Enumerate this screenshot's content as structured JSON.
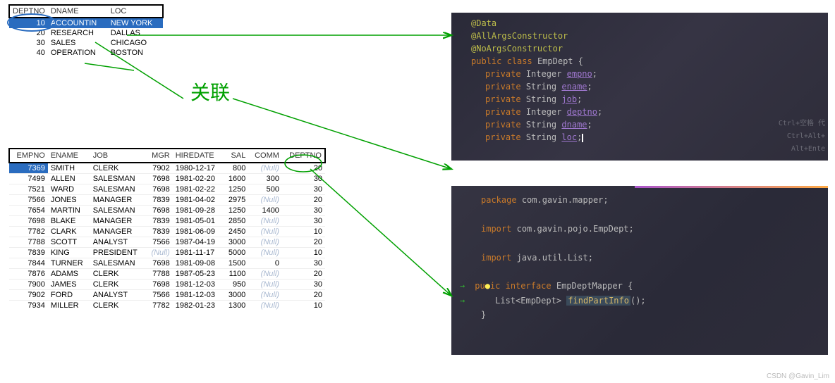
{
  "annotation_label": "关联",
  "dept_table": {
    "headers": [
      "DEPTNO",
      "DNAME",
      "LOC"
    ],
    "rows": [
      {
        "deptno": "10",
        "dname": "ACCOUNTIN",
        "loc": "NEW YORK",
        "selected": true
      },
      {
        "deptno": "20",
        "dname": "RESEARCH",
        "loc": "DALLAS"
      },
      {
        "deptno": "30",
        "dname": "SALES",
        "loc": "CHICAGO"
      },
      {
        "deptno": "40",
        "dname": "OPERATION",
        "loc": "BOSTON"
      }
    ]
  },
  "emp_table": {
    "headers": [
      "EMPNO",
      "ENAME",
      "JOB",
      "MGR",
      "HIREDATE",
      "SAL",
      "COMM",
      "DEPTNO"
    ],
    "rows": [
      {
        "empno": "7369",
        "ename": "SMITH",
        "job": "CLERK",
        "mgr": "7902",
        "hiredate": "1980-12-17",
        "sal": "800",
        "comm": "(Null)",
        "deptno": "20",
        "selected": true
      },
      {
        "empno": "7499",
        "ename": "ALLEN",
        "job": "SALESMAN",
        "mgr": "7698",
        "hiredate": "1981-02-20",
        "sal": "1600",
        "comm": "300",
        "deptno": "30"
      },
      {
        "empno": "7521",
        "ename": "WARD",
        "job": "SALESMAN",
        "mgr": "7698",
        "hiredate": "1981-02-22",
        "sal": "1250",
        "comm": "500",
        "deptno": "30"
      },
      {
        "empno": "7566",
        "ename": "JONES",
        "job": "MANAGER",
        "mgr": "7839",
        "hiredate": "1981-04-02",
        "sal": "2975",
        "comm": "(Null)",
        "deptno": "20"
      },
      {
        "empno": "7654",
        "ename": "MARTIN",
        "job": "SALESMAN",
        "mgr": "7698",
        "hiredate": "1981-09-28",
        "sal": "1250",
        "comm": "1400",
        "deptno": "30"
      },
      {
        "empno": "7698",
        "ename": "BLAKE",
        "job": "MANAGER",
        "mgr": "7839",
        "hiredate": "1981-05-01",
        "sal": "2850",
        "comm": "(Null)",
        "deptno": "30"
      },
      {
        "empno": "7782",
        "ename": "CLARK",
        "job": "MANAGER",
        "mgr": "7839",
        "hiredate": "1981-06-09",
        "sal": "2450",
        "comm": "(Null)",
        "deptno": "10"
      },
      {
        "empno": "7788",
        "ename": "SCOTT",
        "job": "ANALYST",
        "mgr": "7566",
        "hiredate": "1987-04-19",
        "sal": "3000",
        "comm": "(Null)",
        "deptno": "20"
      },
      {
        "empno": "7839",
        "ename": "KING",
        "job": "PRESIDENT",
        "mgr": "(Null)",
        "hiredate": "1981-11-17",
        "sal": "5000",
        "comm": "(Null)",
        "deptno": "10"
      },
      {
        "empno": "7844",
        "ename": "TURNER",
        "job": "SALESMAN",
        "mgr": "7698",
        "hiredate": "1981-09-08",
        "sal": "1500",
        "comm": "0",
        "deptno": "30"
      },
      {
        "empno": "7876",
        "ename": "ADAMS",
        "job": "CLERK",
        "mgr": "7788",
        "hiredate": "1987-05-23",
        "sal": "1100",
        "comm": "(Null)",
        "deptno": "20"
      },
      {
        "empno": "7900",
        "ename": "JAMES",
        "job": "CLERK",
        "mgr": "7698",
        "hiredate": "1981-12-03",
        "sal": "950",
        "comm": "(Null)",
        "deptno": "30"
      },
      {
        "empno": "7902",
        "ename": "FORD",
        "job": "ANALYST",
        "mgr": "7566",
        "hiredate": "1981-12-03",
        "sal": "3000",
        "comm": "(Null)",
        "deptno": "20"
      },
      {
        "empno": "7934",
        "ename": "MILLER",
        "job": "CLERK",
        "mgr": "7782",
        "hiredate": "1982-01-23",
        "sal": "1300",
        "comm": "(Null)",
        "deptno": "10"
      }
    ]
  },
  "code1": {
    "annotations": [
      "@Data",
      "@AllArgsConstructor",
      "@NoArgsConstructor"
    ],
    "class_decl": {
      "kw1": "public",
      "kw2": "class",
      "name": "EmpDept"
    },
    "fields": [
      {
        "kw": "private",
        "type": "Integer",
        "name": "empno"
      },
      {
        "kw": "private",
        "type": "String",
        "name": "ename"
      },
      {
        "kw": "private",
        "type": "String",
        "name": "job"
      },
      {
        "kw": "private",
        "type": "Integer",
        "name": "deptno"
      },
      {
        "kw": "private",
        "type": "String",
        "name": "dname"
      },
      {
        "kw": "private",
        "type": "String",
        "name": "loc"
      }
    ],
    "hints": [
      "Ctrl+空格 代",
      "Ctrl+Alt+",
      "Alt+Ente"
    ]
  },
  "code2": {
    "package_kw": "package",
    "package_name": "com.gavin.mapper;",
    "imports": [
      {
        "kw": "import",
        "val": "com.gavin.pojo.EmpDept;"
      },
      {
        "kw": "import",
        "val": "java.util.List;"
      }
    ],
    "interface_decl": {
      "kw1": "public",
      "kw2": "interface",
      "name": "EmpDeptMapper"
    },
    "method": {
      "ret": "List<EmpDept>",
      "name": "findPartInfo",
      "suffix": "();"
    }
  },
  "watermark": "CSDN @Gavin_Lim"
}
